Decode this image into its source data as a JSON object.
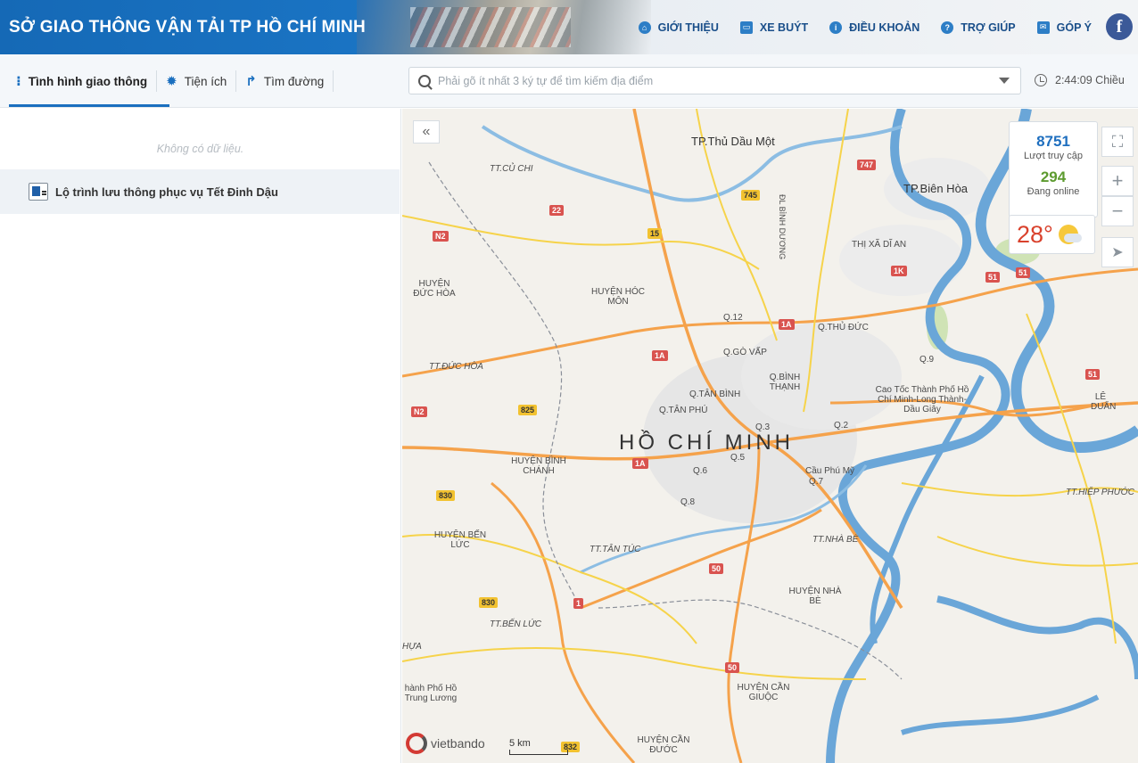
{
  "header": {
    "brand": "SỞ GIAO THÔNG VẬN TẢI TP HỒ CHÍ MINH",
    "nav": [
      {
        "label": "GIỚI THIỆU",
        "icon": "home-icon"
      },
      {
        "label": "XE BUÝT",
        "icon": "bus-icon"
      },
      {
        "label": "ĐIỀU KHOẢN",
        "icon": "info-icon"
      },
      {
        "label": "TRỢ GIÚP",
        "icon": "help-icon"
      },
      {
        "label": "GÓP Ý",
        "icon": "mail-icon"
      }
    ],
    "facebook": "f"
  },
  "toolbar": {
    "tabs": [
      {
        "label": "Tình hình giao thông",
        "icon": "traffic-light-icon",
        "active": true
      },
      {
        "label": "Tiện ích",
        "icon": "gear-icon",
        "active": false
      },
      {
        "label": "Tìm đường",
        "icon": "route-arrow-icon",
        "active": false
      }
    ],
    "search_placeholder": "Phải gõ ít nhất 3 ký tự để tìm kiếm địa điểm",
    "time": "2:44:09 Chiều"
  },
  "sidebar": {
    "empty_text": "Không có dữ liệu.",
    "route_item": "Lộ trình lưu thông phục vụ Tết Đinh Dậu"
  },
  "map": {
    "collapse": "«",
    "stats": {
      "visits": "8751",
      "visits_label": "Lượt truy cập",
      "online": "294",
      "online_label": "Đang online"
    },
    "weather": "28°",
    "controls": {
      "zoom_in": "+",
      "zoom_out": "−",
      "locate": "➤",
      "fullscreen": "⛶"
    },
    "logo": "vietbando",
    "scale": "5 km",
    "big_label": "HỒ CHÍ MINH",
    "places": {
      "thudaumot": "TP.Thủ Dầu Một",
      "bienhoa": "TP.Biên Hòa",
      "cuchi": "TT.CỦ CHI",
      "ducHoa": "HUYỆN ĐỨC HÒA",
      "hocmon": "HUYỆN HÓC MÔN",
      "ducHoaTT": "TT.ĐỨC HÒA",
      "binhChanh": "HUYỆN BÌNH CHÁNH",
      "benLuc": "HUYỆN BẾN LỨC",
      "tanTuc": "TT.TÂN TÚC",
      "benLucTT": "TT.BẾN LỨC",
      "q12": "Q.12",
      "goVap": "Q.GÒ VẤP",
      "tanBinh": "Q.TÂN BÌNH",
      "tanPhu": "Q.TÂN PHÚ",
      "binhThanh": "Q.BÌNH THẠNH",
      "thuDuc": "Q.THỦ ĐỨC",
      "q9": "Q.9",
      "q2": "Q.2",
      "q3": "Q.3",
      "q5": "Q.5",
      "q6": "Q.6",
      "q8": "Q.8",
      "q7": "Q.7",
      "nhaBe": "TT.NHÀ BÈ",
      "huyenNhaBe": "HUYỆN NHÀ BÈ",
      "canGiuoc": "HUYỆN CẦN GIUỘC",
      "canDuoc": "HUYỆN CẦN ĐƯỚC",
      "diAn": "THỊ XÃ DĨ AN",
      "hiepPhuoc": "TT.HIỆP PHƯỚC",
      "leDuan": "LÊ DUẨN",
      "cauPhuMy": "Cầu Phú Mỹ",
      "caoToc": "Cao Tốc Thành Phố Hồ Chí Minh-Long Thành-Dầu Giây",
      "trungLuong": "hành Phố Hồ Trung Lương",
      "hua": "HỰA",
      "dlBinhDuong": "ĐL BÌNH DƯƠNG"
    },
    "shields": {
      "s747": "747",
      "s745": "745",
      "s22": "22",
      "s15": "15",
      "sN2a": "N2",
      "sN2b": "N2",
      "s1K": "1K",
      "s51a": "51",
      "s51b": "51",
      "s51c": "51",
      "s1Aa": "1A",
      "s1Ab": "1A",
      "s1Ac": "1A",
      "s825": "825",
      "s830a": "830",
      "s830b": "830",
      "s50a": "50",
      "s50b": "50",
      "s1": "1",
      "s832": "832"
    }
  }
}
